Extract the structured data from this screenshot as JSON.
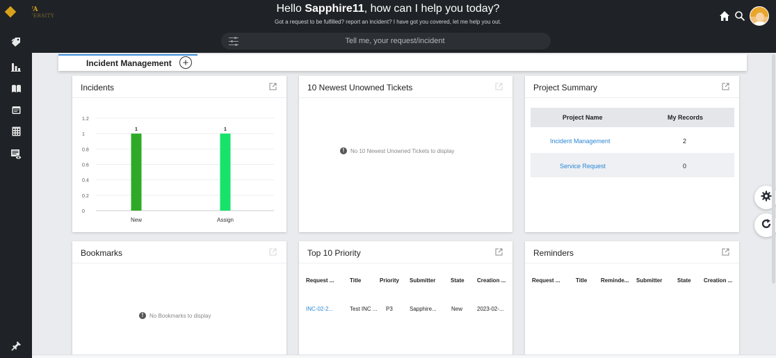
{
  "header": {
    "logo_name": "REVA",
    "logo_sub": "UNIVERSITY",
    "greeting_prefix": "Hello ",
    "username": "Sapphire11",
    "greeting_suffix": ", how can I help you today?",
    "subtitle": "Got a request to be fulfilled? report an incident? I have got you covered, let me help you out.",
    "search_placeholder": "Tell me, your request/incident",
    "icons": [
      "home-icon",
      "search-icon",
      "user-avatar"
    ]
  },
  "sidebar": {
    "items": [
      {
        "icon": "tag-icon"
      },
      {
        "icon": "bar-chart-icon"
      },
      {
        "icon": "book-icon"
      },
      {
        "icon": "window-icon"
      },
      {
        "icon": "calendar-grid-icon"
      },
      {
        "icon": "monitor-eye-icon"
      }
    ],
    "bottom_icon": "pin-icon"
  },
  "tabs": [
    {
      "label": "Incident Management",
      "active": true
    }
  ],
  "cards": {
    "incidents": {
      "title": "Incidents"
    },
    "newest_unowned": {
      "title": "10 Newest Unowned Tickets",
      "empty_message": "No 10 Newest Unowned Tickets to display"
    },
    "project_summary": {
      "title": "Project Summary",
      "columns": [
        "Project Name",
        "My Records"
      ],
      "rows": [
        {
          "name": "Incident Management",
          "records": "2"
        },
        {
          "name": "Service Request",
          "records": "0"
        }
      ]
    },
    "bookmarks": {
      "title": "Bookmarks",
      "empty_message": "No Bookmarks to display"
    },
    "top_priority": {
      "title": "Top 10 Priority",
      "columns": [
        "Request ...",
        "Title",
        "Priority",
        "Submitter",
        "State",
        "Creation ..."
      ],
      "rows": [
        {
          "request": "INC-02-2...",
          "title": "Test INC ...",
          "priority": "P3",
          "submitter": "Sapphire...",
          "state": "New",
          "creation": "2023-02-..."
        }
      ]
    },
    "reminders": {
      "title": "Reminders",
      "columns": [
        "Request ...",
        "Title",
        "Reminde...",
        "Submitter",
        "State",
        "Creation ..."
      ]
    }
  },
  "chart_data": {
    "type": "bar",
    "categories": [
      "New",
      "Assign"
    ],
    "values": [
      1,
      1
    ],
    "data_labels": [
      "1",
      "1"
    ],
    "ylim": [
      0,
      1.2
    ],
    "yticks": [
      "0",
      "0.2",
      "0.4",
      "0.6",
      "0.8",
      "1",
      "1.2"
    ],
    "colors": [
      "#2eaa28",
      "#17e36a"
    ],
    "grid": true
  },
  "colors": {
    "header_bg": "#1f2226",
    "accent_gold": "#d8a21a",
    "link": "#2b86d4",
    "tab_active_border": "#3d8fd8"
  }
}
